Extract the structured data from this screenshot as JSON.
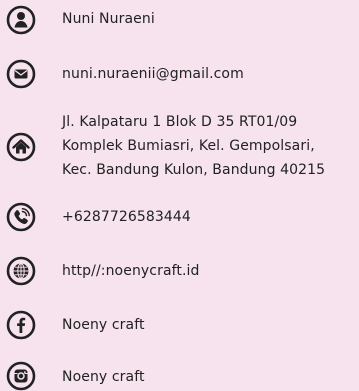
{
  "contact": {
    "name": {
      "icon": "user-icon",
      "text": "Nuni Nuraeni"
    },
    "email": {
      "icon": "mail-icon",
      "text": "nuni.nuraenii@gmail.com"
    },
    "address": {
      "icon": "home-icon",
      "lines": [
        "Jl. Kalpataru 1 Blok D 35 RT01/09",
        "Komplek Bumiasri, Kel. Gempolsari,",
        "Kec. Bandung Kulon, Bandung 40215"
      ]
    },
    "phone": {
      "icon": "phone-icon",
      "text": "+6287726583444"
    },
    "website": {
      "icon": "globe-icon",
      "text": "http//:noenycraft.id"
    },
    "facebook": {
      "icon": "facebook-icon",
      "text": "Noeny craft"
    },
    "instagram": {
      "icon": "instagram-icon",
      "text": "Noeny craft"
    }
  },
  "colors": {
    "background": "#f6e3ed",
    "icon": "#222222",
    "text": "#222222"
  }
}
